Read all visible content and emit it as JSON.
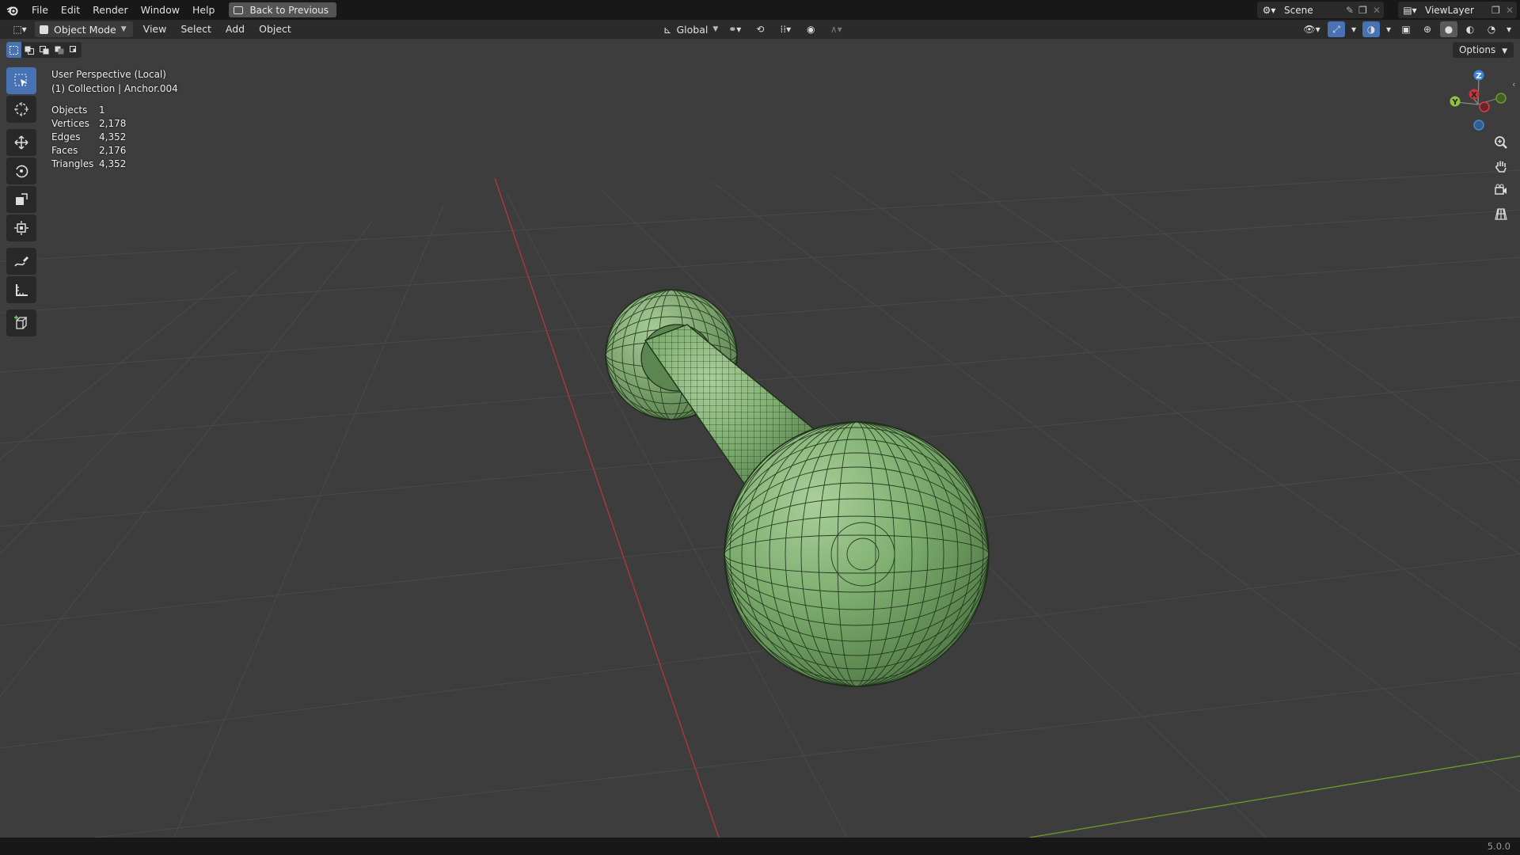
{
  "menubar": {
    "items": [
      "File",
      "Edit",
      "Render",
      "Window",
      "Help"
    ],
    "back_button": "Back to Previous",
    "scene": "Scene",
    "view_layer": "ViewLayer"
  },
  "header": {
    "mode": "Object Mode",
    "menus": [
      "View",
      "Select",
      "Add",
      "Object"
    ],
    "transform_orientation": "Global",
    "options_label": "Options"
  },
  "viewport": {
    "view_name": "User Perspective (Local)",
    "collection_line": "(1) Collection | Anchor.004",
    "stats": [
      {
        "label": "Objects",
        "value": "1"
      },
      {
        "label": "Vertices",
        "value": "2,178"
      },
      {
        "label": "Edges",
        "value": "4,352"
      },
      {
        "label": "Faces",
        "value": "2,176"
      },
      {
        "label": "Triangles",
        "value": "4,352"
      }
    ],
    "gizmo_axes": {
      "z": "Z",
      "x": "X",
      "y": "Y"
    },
    "mesh_color": "#78a66a",
    "x_axis_color": "#b3383c",
    "y_axis_color": "#6e9a2c"
  },
  "toolbar": {
    "tools": [
      "select-box-icon",
      "cursor-icon",
      "move-icon",
      "rotate-icon",
      "scale-icon",
      "transform-icon",
      "annotate-icon",
      "measure-icon",
      "add-cube-icon"
    ]
  },
  "statusbar": {
    "version": "5.0.0"
  }
}
